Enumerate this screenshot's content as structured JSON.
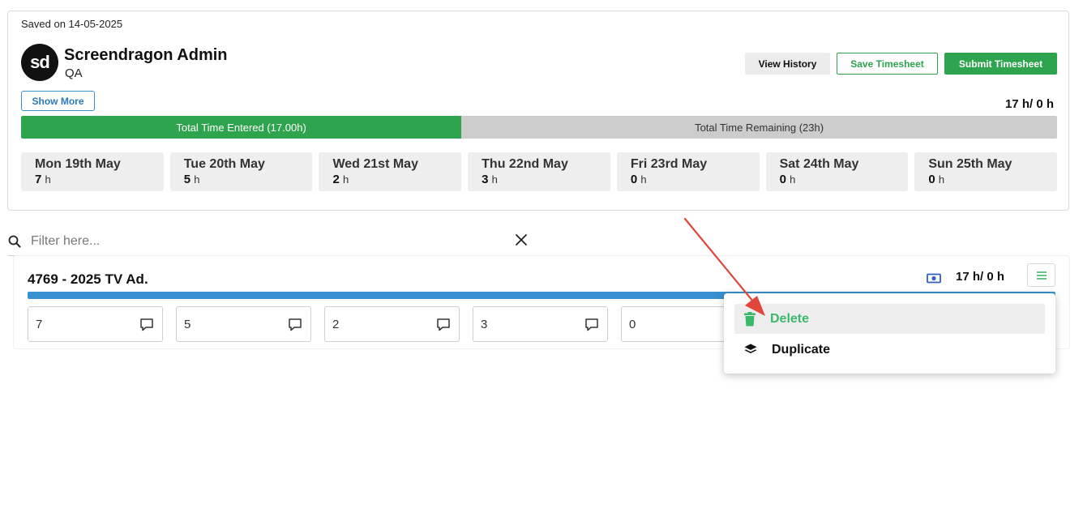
{
  "header": {
    "saved_text": "Saved on 14-05-2025",
    "avatar_initials": "sd",
    "user_name": "Screendragon Admin",
    "user_role": "QA",
    "show_more_label": "Show More",
    "total_hours": "17 h/ 0 h",
    "buttons": {
      "view_history": "View History",
      "save_timesheet": "Save Timesheet",
      "submit_timesheet": "Submit Timesheet"
    },
    "progress": {
      "entered_label": "Total Time Entered (17.00h)",
      "remaining_label": "Total Time Remaining (23h)",
      "entered_fraction": 0.425
    },
    "days": [
      {
        "name": "Mon 19th May",
        "hours": "7",
        "unit": "h"
      },
      {
        "name": "Tue 20th May",
        "hours": "5",
        "unit": "h"
      },
      {
        "name": "Wed 21st May",
        "hours": "2",
        "unit": "h"
      },
      {
        "name": "Thu 22nd May",
        "hours": "3",
        "unit": "h"
      },
      {
        "name": "Fri 23rd May",
        "hours": "0",
        "unit": "h"
      },
      {
        "name": "Sat 24th May",
        "hours": "0",
        "unit": "h"
      },
      {
        "name": "Sun 25th May",
        "hours": "0",
        "unit": "h"
      }
    ]
  },
  "filter": {
    "placeholder": "Filter here...",
    "icon": "search-icon",
    "clear_icon": "close-icon"
  },
  "project": {
    "title": "4769 - 2025 TV Ad.",
    "hours": "17 h/ 0 h",
    "billing_icon": "money-icon",
    "menu_icon": "menu-icon",
    "entries": [
      "7",
      "5",
      "2",
      "3",
      "0"
    ],
    "comment_icon": "comment-icon"
  },
  "menu": {
    "delete_label": "Delete",
    "duplicate_label": "Duplicate",
    "delete_icon": "trash-icon",
    "duplicate_icon": "layers-icon"
  },
  "colors": {
    "green": "#2ea44f",
    "blue": "#3790d0",
    "annotation_arrow": "#e0473a"
  }
}
